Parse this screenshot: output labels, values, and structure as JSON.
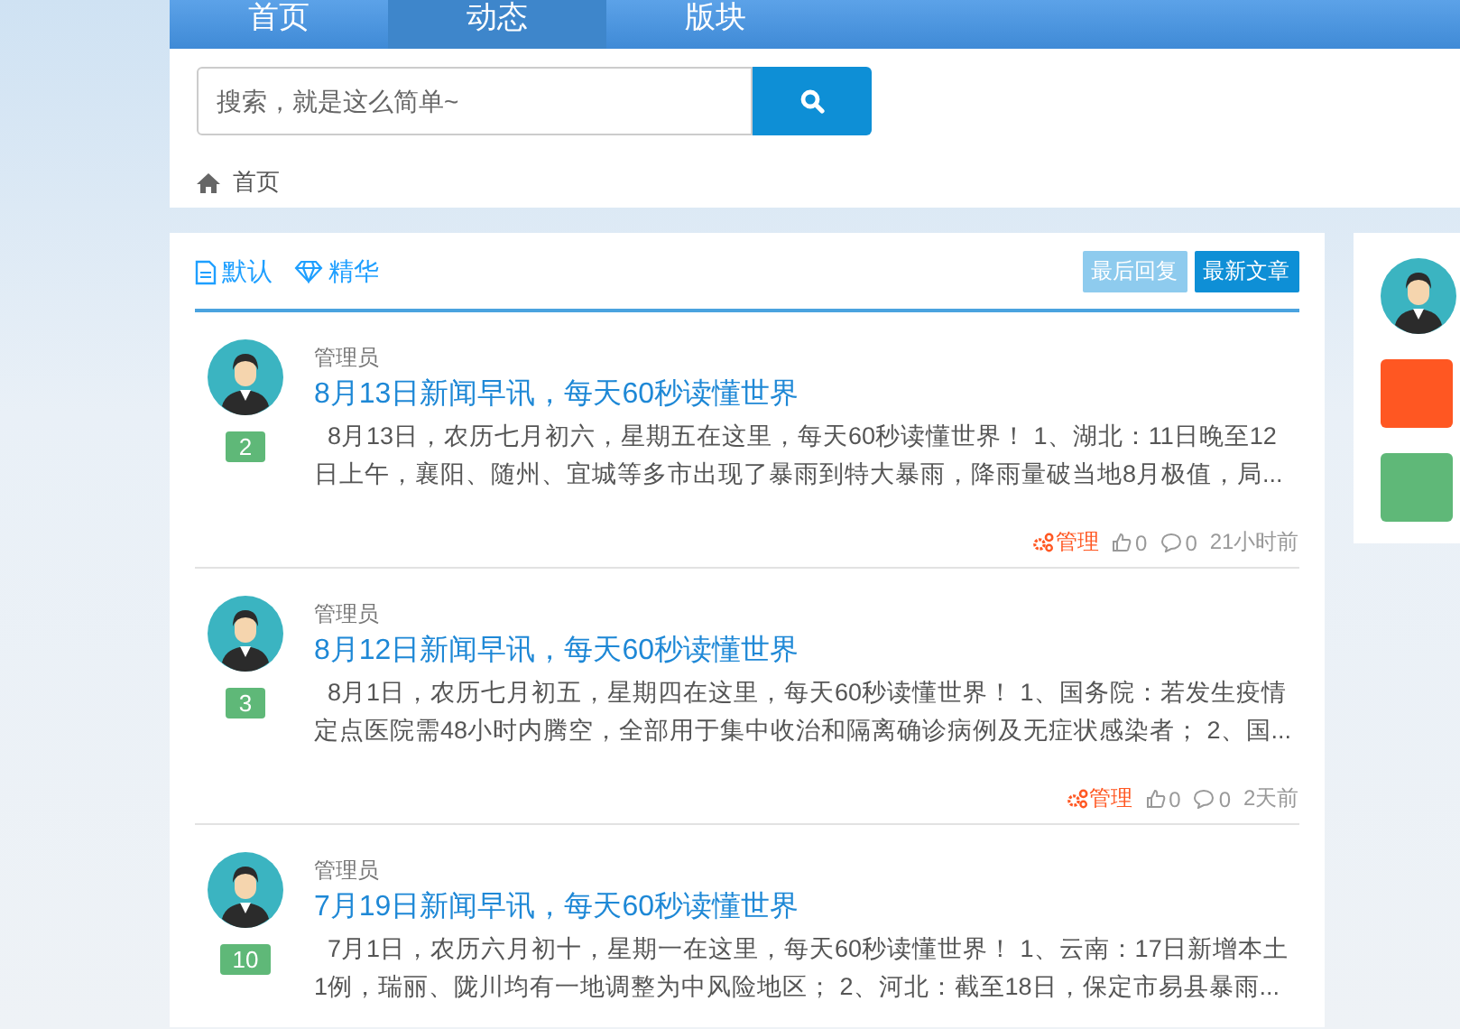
{
  "nav": {
    "tabs": [
      {
        "label": "首页",
        "selected": false
      },
      {
        "label": "动态",
        "selected": true
      },
      {
        "label": "版块",
        "selected": false
      }
    ]
  },
  "search": {
    "placeholder": "搜索，就是这么简单~"
  },
  "breadcrumb": {
    "label": "首页"
  },
  "filters": [
    {
      "label": "默认",
      "kind": "document"
    },
    {
      "label": "精华",
      "kind": "diamond"
    }
  ],
  "sort_buttons": [
    {
      "label": "最后回复",
      "selected": false
    },
    {
      "label": "最新文章",
      "selected": true
    }
  ],
  "posts": [
    {
      "author": "管理员",
      "title": "8月13日新闻早讯，每天60秒读懂世界",
      "excerpt": "  8月13日，农历七月初六，星期五在这里，每天60秒读懂世界！ 1、湖北：11日晚至12日上午，襄阳、随州、宜城等多市出现了暴雨到特大暴雨，降雨量破当地8月极值，局...",
      "badge": "2",
      "manage": "管理",
      "likes": "0",
      "comments": "0",
      "time": "21小时前"
    },
    {
      "author": "管理员",
      "title": "8月12日新闻早讯，每天60秒读懂世界",
      "excerpt": "  8月1日，农历七月初五，星期四在这里，每天60秒读懂世界！ 1、国务院：若发生疫情定点医院需48小时内腾空，全部用于集中收治和隔离确诊病例及无症状感染者； 2、国...",
      "badge": "3",
      "manage": "管理",
      "likes": "0",
      "comments": "0",
      "time": "2天前"
    },
    {
      "author": "管理员",
      "title": "7月19日新闻早讯，每天60秒读懂世界",
      "excerpt": "  7月1日，农历六月初十，星期一在这里，每天60秒读懂世界！ 1、云南：17日新增本土1例，瑞丽、陇川均有一地调整为中风险地区； 2、河北：截至18日，保定市易县暴雨...",
      "badge": "10"
    }
  ],
  "sidebar": {
    "buttons": [
      {
        "color": "#ff5722"
      },
      {
        "color": "#5fb878"
      }
    ]
  }
}
